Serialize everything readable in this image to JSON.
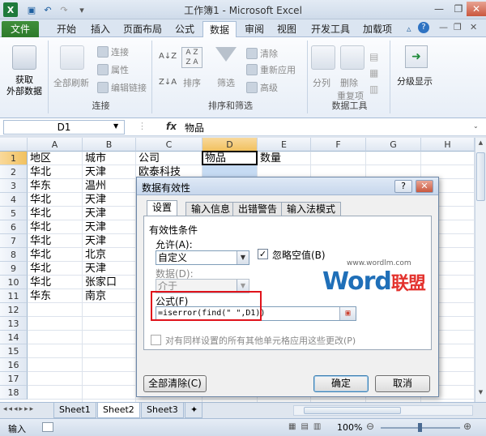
{
  "window": {
    "title": "工作簿1 - Microsoft Excel"
  },
  "ribbon_tabs": [
    "文件",
    "开始",
    "插入",
    "页面布局",
    "公式",
    "数据",
    "审阅",
    "视图",
    "开发工具",
    "加载项"
  ],
  "ribbon": {
    "get_external": [
      "获取",
      "外部数据"
    ],
    "refresh_all": "全部刷新",
    "connection_items": [
      "连接",
      "属性",
      "编辑链接"
    ],
    "connections_group": "连接",
    "sort_label": "排序",
    "filter_label": "筛选",
    "filter_items": [
      "清除",
      "重新应用",
      "高级"
    ],
    "sortfilter_group": "排序和筛选",
    "split_label": "分列",
    "dedupe_label": [
      "删除",
      "重复项"
    ],
    "datatools_group": "数据工具",
    "outline_label": "分级显示"
  },
  "formula_bar": {
    "name_box": "D1",
    "fx": "fx",
    "content": "物品"
  },
  "columns": [
    "A",
    "B",
    "C",
    "D",
    "E",
    "F",
    "G",
    "H"
  ],
  "rows": [
    "1",
    "2",
    "3",
    "4",
    "5",
    "6",
    "7",
    "8",
    "9",
    "10",
    "11",
    "12",
    "13",
    "14",
    "15",
    "16",
    "17",
    "18"
  ],
  "cells": [
    [
      "地区",
      "城市",
      "公司",
      "物品",
      "数量"
    ],
    [
      "华北",
      "天津",
      "欧泰科技"
    ],
    [
      "华东",
      "温州",
      ""
    ],
    [
      "华北",
      "天津",
      ""
    ],
    [
      "华北",
      "天津",
      ""
    ],
    [
      "华北",
      "天津",
      ""
    ],
    [
      "华北",
      "天津",
      ""
    ],
    [
      "华北",
      "北京",
      ""
    ],
    [
      "华北",
      "天津",
      ""
    ],
    [
      "华北",
      "张家口",
      ""
    ],
    [
      "华东",
      "南京",
      ""
    ]
  ],
  "sheet_tabs": [
    "Sheet1",
    "Sheet2",
    "Sheet3"
  ],
  "status": {
    "mode": "输入",
    "zoom": "100%"
  },
  "dialog": {
    "title": "数据有效性",
    "help": "?",
    "close": "✕",
    "tabs": [
      "设置",
      "输入信息",
      "出错警告",
      "输入法模式"
    ],
    "section_title": "有效性条件",
    "allow_label": "允许(A):",
    "allow_value": "自定义",
    "ignore_blank": "忽略空值(B)",
    "data_label": "数据(D):",
    "data_value": "介于",
    "formula_label": "公式(F)",
    "formula_value": "=iserror(find(\" \",D1))",
    "apply_all": "对有同样设置的所有其他单元格应用这些更改(P)",
    "clear_all": "全部清除(C)",
    "ok": "确定",
    "cancel": "取消"
  },
  "watermark": {
    "brand": "Word",
    "cn": "联盟",
    "url": "www.wordlm.com"
  }
}
